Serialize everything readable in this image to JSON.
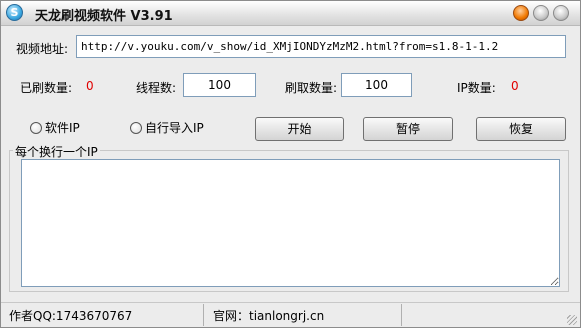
{
  "window": {
    "title": "天龙刷视频软件 V3.91",
    "icon_glyph": "S"
  },
  "form": {
    "url_label": "视频地址:",
    "url_value": "http://v.youku.com/v_show/id_XMjIONDYzMzM2.html?from=s1.8-1-1.2",
    "brushed_count_label": "已刷数量:",
    "brushed_count_value": "0",
    "threads_label": "线程数:",
    "threads_value": "100",
    "fetch_count_label": "刷取数量:",
    "fetch_count_value": "100",
    "ip_count_label": "IP数量:",
    "ip_count_value": "0"
  },
  "options": {
    "software_ip_label": "软件IP",
    "custom_ip_label": "自行导入IP"
  },
  "buttons": {
    "start": "开始",
    "pause": "暂停",
    "resume": "恢复"
  },
  "ip_box": {
    "caption": "每个换行一个IP"
  },
  "status": {
    "author": "作者QQ:1743670767",
    "website": "官网：tianlongrj.cn"
  },
  "colors": {
    "count_value": "#e00000",
    "window_bg": "#ececec"
  },
  "icons": [
    "app-logo-icon",
    "minimize-icon",
    "maximize-icon",
    "close-icon",
    "resize-grip-icon"
  ]
}
